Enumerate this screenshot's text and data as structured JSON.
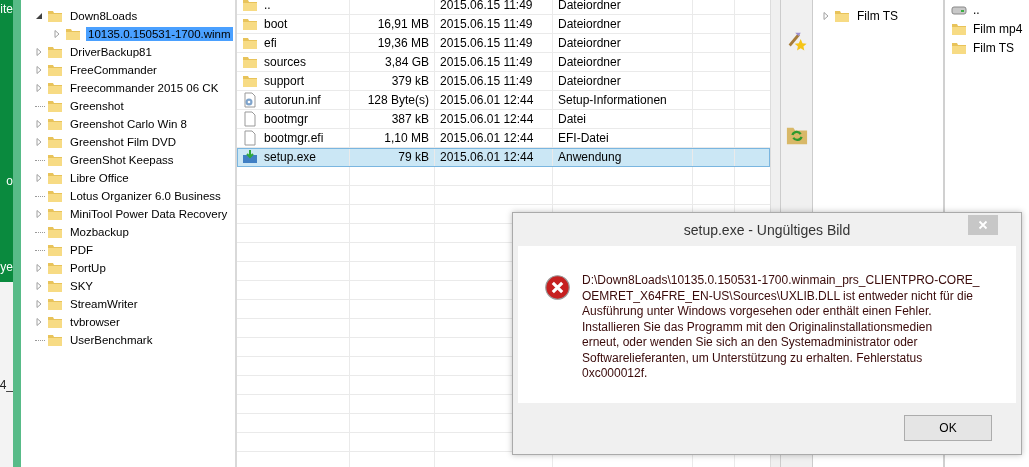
{
  "left_strip": {
    "texts": [
      "ite",
      "o",
      "ye",
      "4_"
    ]
  },
  "tree": {
    "items": [
      {
        "label": "Down8Loads",
        "kind": "branch",
        "expanded": true,
        "selected": false,
        "children": [
          {
            "label": "10135.0.150531-1700.winm",
            "kind": "branch",
            "expanded": false,
            "selected": true
          }
        ]
      },
      {
        "label": "DriverBackup81",
        "kind": "branch",
        "expanded": false,
        "selected": false
      },
      {
        "label": "FreeCommander",
        "kind": "branch",
        "expanded": false,
        "selected": false
      },
      {
        "label": "Freecommander 2015 06 CK",
        "kind": "branch",
        "expanded": false,
        "selected": false
      },
      {
        "label": "Greenshot",
        "kind": "leaf",
        "selected": false
      },
      {
        "label": "Greenshot Carlo Win 8",
        "kind": "branch",
        "expanded": false,
        "selected": false
      },
      {
        "label": "Greenshot Film DVD",
        "kind": "branch",
        "expanded": false,
        "selected": false
      },
      {
        "label": "GreenShot Keepass",
        "kind": "leaf",
        "selected": false
      },
      {
        "label": "Libre Office",
        "kind": "branch",
        "expanded": false,
        "selected": false
      },
      {
        "label": "Lotus Organizer 6.0 Business",
        "kind": "leaf",
        "selected": false
      },
      {
        "label": "MiniTool Power Data Recovery",
        "kind": "branch",
        "expanded": false,
        "selected": false
      },
      {
        "label": "Mozbackup",
        "kind": "leaf",
        "selected": false
      },
      {
        "label": "PDF",
        "kind": "leaf",
        "selected": false
      },
      {
        "label": "PortUp",
        "kind": "branch",
        "expanded": false,
        "selected": false
      },
      {
        "label": "SKY",
        "kind": "branch",
        "expanded": false,
        "selected": false
      },
      {
        "label": "StreamWriter",
        "kind": "branch",
        "expanded": false,
        "selected": false
      },
      {
        "label": "tvbrowser",
        "kind": "branch",
        "expanded": false,
        "selected": false
      },
      {
        "label": "UserBenchmark",
        "kind": "leaf",
        "selected": false
      }
    ]
  },
  "file_list": {
    "rows": [
      {
        "kind": "folder",
        "name": "..",
        "date": "2015.06.15 11:49",
        "type": "Dateiordner",
        "selected": false
      },
      {
        "kind": "folder",
        "name": "boot",
        "size": "16,91 MB",
        "date": "2015.06.15 11:49",
        "type": "Dateiordner",
        "selected": false
      },
      {
        "kind": "folder",
        "name": "efi",
        "size": "19,36 MB",
        "date": "2015.06.15 11:49",
        "type": "Dateiordner",
        "selected": false
      },
      {
        "kind": "folder",
        "name": "sources",
        "size": "3,84 GB",
        "date": "2015.06.15 11:49",
        "type": "Dateiordner",
        "selected": false
      },
      {
        "kind": "folder",
        "name": "support",
        "size": "379 kB",
        "date": "2015.06.15 11:49",
        "type": "Dateiordner",
        "selected": false
      },
      {
        "kind": "settings",
        "name": "autorun.inf",
        "size": "128 Byte(s)",
        "date": "2015.06.01 12:44",
        "type": "Setup-Informationen",
        "selected": false
      },
      {
        "kind": "file",
        "name": "bootmgr",
        "size": "387 kB",
        "date": "2015.06.01 12:44",
        "type": "Datei",
        "selected": false
      },
      {
        "kind": "file",
        "name": "bootmgr.efi",
        "size": "1,10 MB",
        "date": "2015.06.01 12:44",
        "type": "EFI-Datei",
        "selected": false
      },
      {
        "kind": "exe",
        "name": "setup.exe",
        "size": "79 kB",
        "date": "2015.06.01 12:44",
        "type": "Anwendung",
        "selected": true
      }
    ]
  },
  "right_tree": {
    "items": [
      {
        "label": "Film TS",
        "kind": "branch",
        "expanded": false,
        "selected": false
      }
    ]
  },
  "right_list": {
    "rows": [
      {
        "kind": "drive",
        "name": ".."
      },
      {
        "kind": "folder",
        "name": "Film mp4"
      },
      {
        "kind": "folder",
        "name": "Film TS"
      }
    ]
  },
  "dialog": {
    "title": "setup.exe - Ungültiges Bild",
    "message": "D:\\Down8Loads\\10135.0.150531-1700.winmain_prs_CLIENTPRO-CORE_\nOEMRET_X64FRE_EN-US\\Sources\\UXLIB.DLL ist entweder nicht für die\nAusführung unter Windows vorgesehen oder enthält einen Fehler.\nInstallieren Sie das Programm mit den Originalinstallationsmedien\nerneut, oder wenden Sie sich an den Systemadministrator oder\nSoftwarelieferanten, um Unterstützung zu erhalten. Fehlerstatus\n0xc000012f.",
    "button": "OK"
  }
}
